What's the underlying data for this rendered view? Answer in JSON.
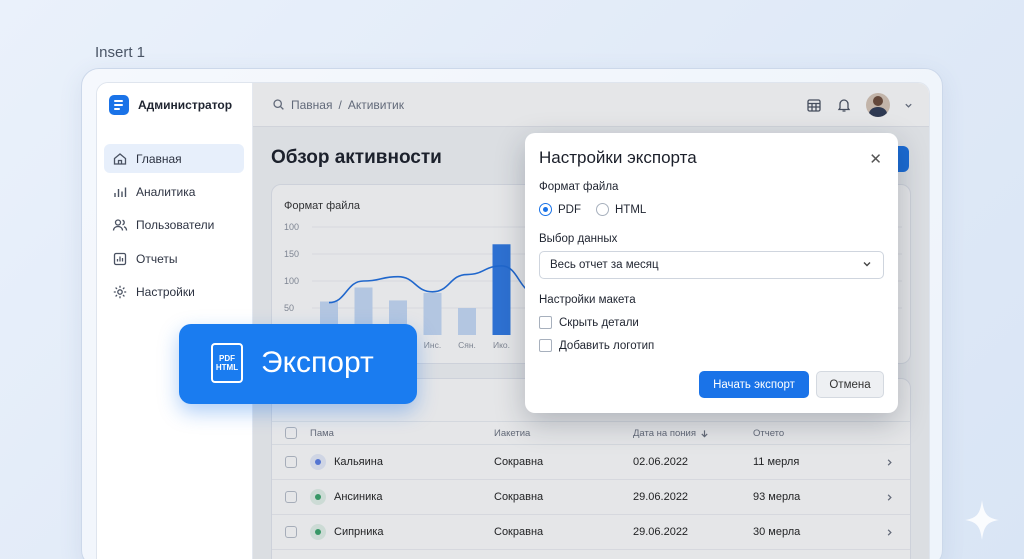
{
  "insert_label": "Insert 1",
  "app": {
    "name": "Администратор"
  },
  "sidebar": {
    "items": [
      {
        "label": "Главная",
        "icon": "home-icon",
        "active": true
      },
      {
        "label": "Аналитика",
        "icon": "bar-chart-icon"
      },
      {
        "label": "Пользователи",
        "icon": "users-icon"
      },
      {
        "label": "Отчеты",
        "icon": "report-icon"
      },
      {
        "label": "Настройки",
        "icon": "gear-icon"
      }
    ]
  },
  "topbar": {
    "crumb_home": "Павная",
    "separator": "/",
    "crumb_current": "Активитик"
  },
  "page": {
    "title": "Обзор активности"
  },
  "chart_card": {
    "title": "Формат файла"
  },
  "chart_data": {
    "type": "bar",
    "yticks": [
      "100",
      "150",
      "100",
      "50"
    ],
    "categories": [
      "",
      "",
      "",
      "Инс.",
      "Сян.",
      "Ико.",
      ""
    ],
    "values": [
      62,
      88,
      64,
      78,
      50,
      168,
      60
    ],
    "line": [
      60,
      100,
      108,
      80,
      112,
      128,
      78
    ],
    "ylim": [
      0,
      200
    ]
  },
  "table": {
    "headers": {
      "name": "Пама",
      "status": "Иакетиа",
      "date": "Дата на пония",
      "report": "Отчето"
    },
    "rows": [
      {
        "name": "Кальяина",
        "status": "Сокравна",
        "date": "02.06.2022",
        "report": "11 мерля",
        "color": "#5b7fe6"
      },
      {
        "name": "Ансиника",
        "status": "Сокравна",
        "date": "29.06.2022",
        "report": "93 мерла",
        "color": "#3aa56b"
      },
      {
        "name": "Сипрника",
        "status": "Сокравна",
        "date": "29.06.2022",
        "report": "30 мерла",
        "color": "#3aa56b"
      }
    ]
  },
  "dialog": {
    "title": "Настройки экспорта",
    "format_label": "Формат файла",
    "format_pdf": "PDF",
    "format_html": "HTML",
    "data_label": "Выбор данных",
    "data_selected": "Весь отчет за месяц",
    "layout_label": "Настройки макета",
    "hide_details": "Скрыть детали",
    "add_logo": "Добавить логотип",
    "start_button": "Начать экспорт",
    "cancel_button": "Отмена"
  },
  "export_badge": {
    "icon_line1": "PDF",
    "icon_line2": "HTML",
    "label": "Экспорт"
  }
}
